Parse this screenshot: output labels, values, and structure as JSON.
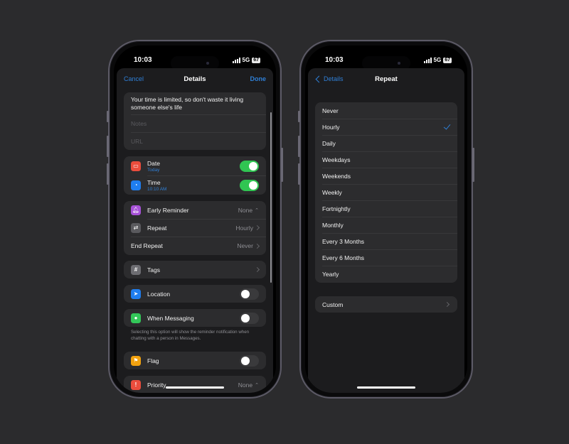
{
  "colors": {
    "accent": "#2f7fd6",
    "toggle_on": "#30c552",
    "background": "#2b2b2d",
    "card": "#2c2c2e",
    "sheet": "#1c1c1e"
  },
  "left_phone": {
    "status": {
      "time": "10:03",
      "network": "5G",
      "battery": "67"
    },
    "nav": {
      "cancel": "Cancel",
      "title": "Details",
      "done": "Done"
    },
    "title_text": "Your time is limited, so don't waste it living someone else's life",
    "notes_placeholder": "Notes",
    "url_placeholder": "URL",
    "date": {
      "label": "Date",
      "sub": "Today",
      "icon": "calendar-icon",
      "enabled": true
    },
    "time": {
      "label": "Time",
      "sub": "10:10 AM",
      "icon": "clock-icon",
      "enabled": true
    },
    "early_reminder": {
      "label": "Early Reminder",
      "value": "None",
      "icon": "bell-icon"
    },
    "repeat": {
      "label": "Repeat",
      "value": "Hourly",
      "icon": "repeat-icon"
    },
    "end_repeat": {
      "label": "End Repeat",
      "value": "Never"
    },
    "tags": {
      "label": "Tags",
      "icon": "hashtag-icon",
      "glyph": "#"
    },
    "location": {
      "label": "Location",
      "icon": "location-arrow-icon",
      "enabled": false
    },
    "when_messaging": {
      "label": "When Messaging",
      "icon": "message-bubble-icon",
      "enabled": false
    },
    "messaging_note": "Selecting this option will show the reminder notification when chatting with a person in Messages.",
    "flag": {
      "label": "Flag",
      "icon": "flag-icon",
      "enabled": false
    },
    "priority": {
      "label": "Priority",
      "value": "None",
      "icon": "exclamation-icon",
      "glyph": "!"
    }
  },
  "right_phone": {
    "status": {
      "time": "10:03",
      "network": "5G",
      "battery": "67"
    },
    "nav": {
      "back": "Details",
      "title": "Repeat"
    },
    "options": [
      {
        "label": "Never",
        "selected": false
      },
      {
        "label": "Hourly",
        "selected": true
      },
      {
        "label": "Daily",
        "selected": false
      },
      {
        "label": "Weekdays",
        "selected": false
      },
      {
        "label": "Weekends",
        "selected": false
      },
      {
        "label": "Weekly",
        "selected": false
      },
      {
        "label": "Fortnightly",
        "selected": false
      },
      {
        "label": "Monthly",
        "selected": false
      },
      {
        "label": "Every 3 Months",
        "selected": false
      },
      {
        "label": "Every 6 Months",
        "selected": false
      },
      {
        "label": "Yearly",
        "selected": false
      }
    ],
    "custom": "Custom"
  }
}
